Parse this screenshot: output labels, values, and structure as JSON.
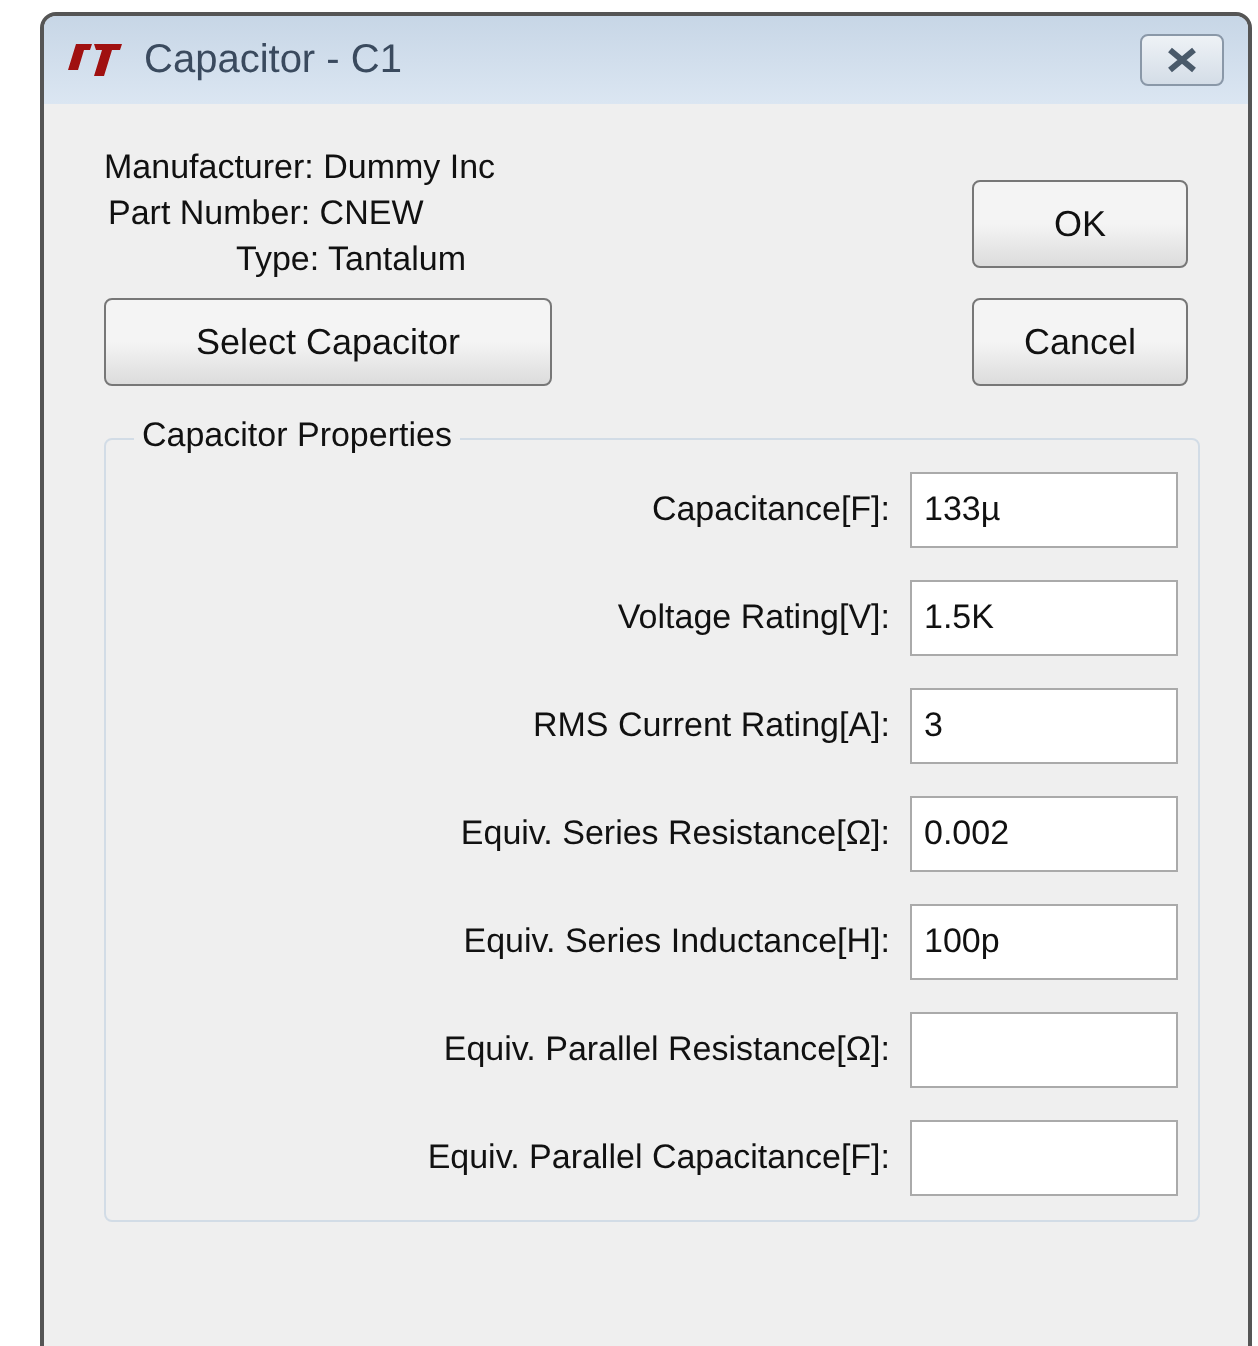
{
  "window": {
    "title": "Capacitor - C1"
  },
  "info": [
    {
      "label": "Manufacturer: Dummy Inc"
    },
    {
      "label": "Part Number: CNEW"
    },
    {
      "label": "Type: Tantalum"
    }
  ],
  "buttons": {
    "ok": "OK",
    "cancel": "Cancel",
    "select": "Select Capacitor"
  },
  "properties": {
    "title": "Capacitor Properties",
    "fields": [
      {
        "label": "Capacitance[F]:",
        "value": "133µ"
      },
      {
        "label": "Voltage Rating[V]:",
        "value": "1.5K"
      },
      {
        "label": "RMS Current Rating[A]:",
        "value": "3"
      },
      {
        "label": "Equiv. Series Resistance[Ω]:",
        "value": "0.002"
      },
      {
        "label": "Equiv. Series Inductance[H]:",
        "value": "100p"
      },
      {
        "label": "Equiv. Parallel Resistance[Ω]:"
      },
      {
        "label": "Equiv. Parallel Capacitance[F]:"
      }
    ]
  }
}
